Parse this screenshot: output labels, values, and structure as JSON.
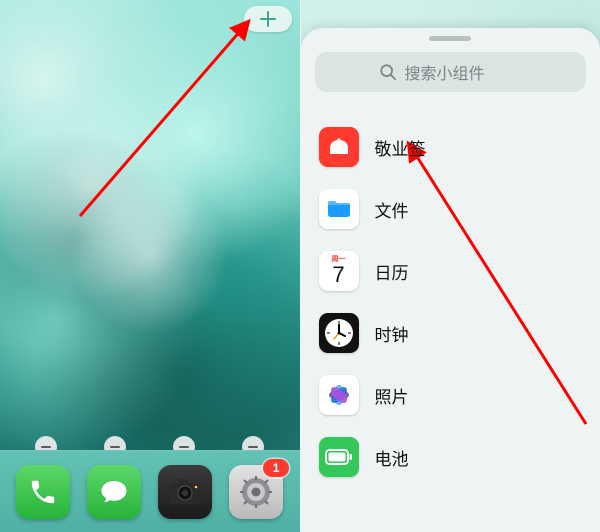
{
  "left": {
    "add_button_icon": "plus-icon",
    "dock": {
      "apps": [
        {
          "name": "phone"
        },
        {
          "name": "messages"
        },
        {
          "name": "camera"
        },
        {
          "name": "settings",
          "badge": "1"
        }
      ]
    }
  },
  "right": {
    "search_placeholder": "搜索小组件",
    "widgets": [
      {
        "id": "jingyeqian",
        "label": "敬业签"
      },
      {
        "id": "files",
        "label": "文件"
      },
      {
        "id": "calendar",
        "label": "日历",
        "weekday": "周一",
        "day": "7"
      },
      {
        "id": "clock",
        "label": "时钟"
      },
      {
        "id": "photos",
        "label": "照片"
      },
      {
        "id": "battery",
        "label": "电池"
      }
    ]
  },
  "annotations": {
    "arrow_color": "#ff0000"
  }
}
